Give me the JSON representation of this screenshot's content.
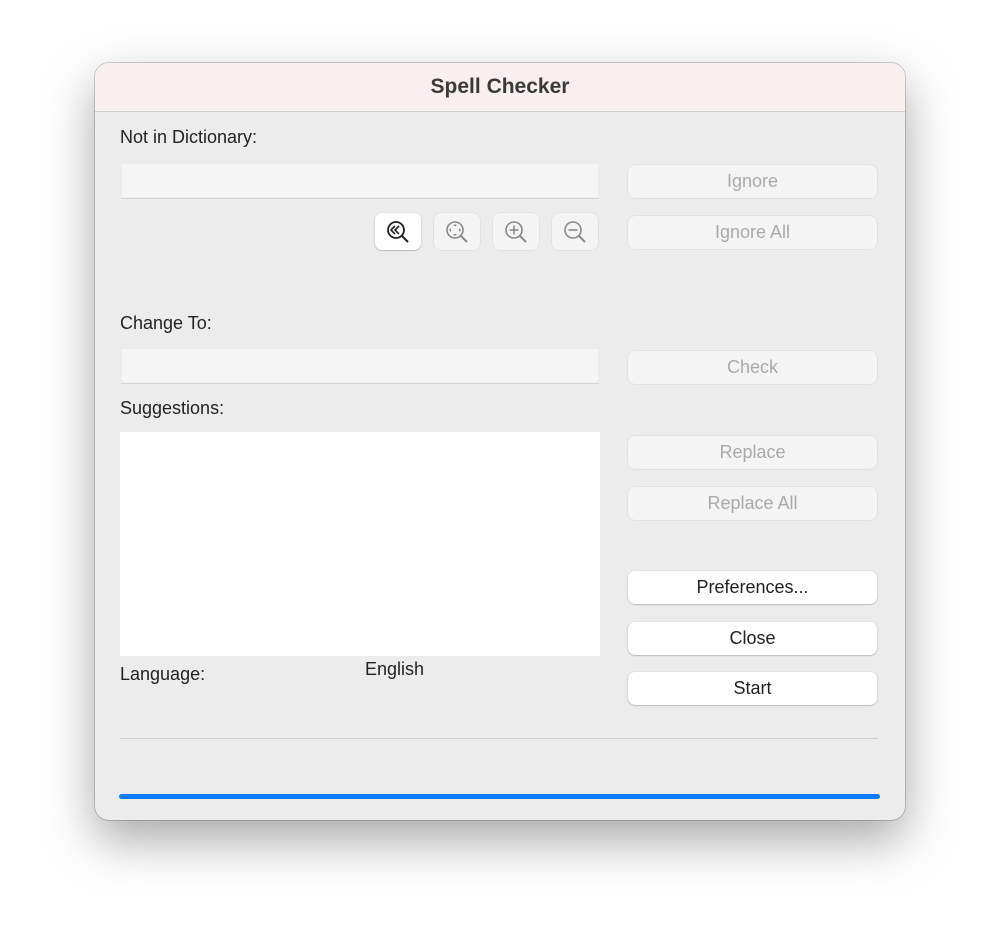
{
  "window": {
    "title": "Spell Checker"
  },
  "labels": {
    "not_in_dictionary": "Not in Dictionary:",
    "change_to": "Change To:",
    "suggestions": "Suggestions:",
    "language": "Language:"
  },
  "fields": {
    "not_in_dictionary_value": "",
    "change_to_value": ""
  },
  "language_value": "English",
  "buttons": {
    "ignore": "Ignore",
    "ignore_all": "Ignore All",
    "check": "Check",
    "replace": "Replace",
    "replace_all": "Replace All",
    "preferences": "Preferences...",
    "close": "Close",
    "start": "Start"
  },
  "icons": [
    "search-previous-icon",
    "search-fit-icon",
    "zoom-in-icon",
    "zoom-out-icon"
  ],
  "progress": {
    "percent": 100,
    "color": "#0a7cff"
  }
}
